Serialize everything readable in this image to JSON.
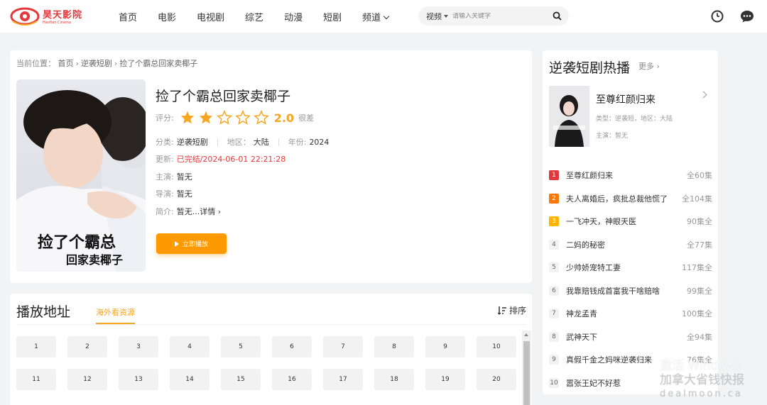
{
  "header": {
    "logo_cn": "昊天影院",
    "logo_en": "Haotian Cinema",
    "nav": [
      "首页",
      "电影",
      "电视剧",
      "综艺",
      "动漫",
      "短剧",
      "频道"
    ],
    "search": {
      "category": "视频",
      "placeholder": "请输入关键字"
    }
  },
  "breadcrumb": {
    "label": "当前位置：",
    "items": [
      "首页",
      "逆袭短剧",
      "捡了个霸总回家卖椰子"
    ]
  },
  "detail": {
    "title": "捡了个霸总回家卖椰子",
    "poster_caption_1": "捡了个霸总",
    "poster_caption_2": "回家卖椰子",
    "rating_label": "评分:",
    "rating_value": 2,
    "rating_max": 5,
    "score": "2.0",
    "score_text": "很差",
    "category_label": "分类:",
    "category": "逆袭短剧",
    "region_label": "地区：",
    "region": "大陆",
    "year_label": "年份:",
    "year": "2024",
    "update_label": "更新:",
    "update": "已完结/2024-06-01 22:21:28",
    "starring_label": "主演:",
    "starring": "暂无",
    "director_label": "导演:",
    "director": "暂无",
    "intro_label": "简介:",
    "intro": "暂无...",
    "intro_more": "详情 ›",
    "play_button": "立即播放"
  },
  "playlist": {
    "title": "播放地址",
    "source": "海外看资源",
    "sort": "排序",
    "episodes": [
      "1",
      "2",
      "3",
      "4",
      "5",
      "6",
      "7",
      "8",
      "9",
      "10",
      "11",
      "12",
      "13",
      "14",
      "15",
      "16",
      "17",
      "18",
      "19",
      "20"
    ]
  },
  "sidebar": {
    "title": "逆袭短剧热播",
    "more": "更多 ›",
    "featured": {
      "title": "至尊红颜归来",
      "type_line": "类型：逆袭短，地区：大陆",
      "cast_line": "主演：暂无"
    },
    "ranks": [
      {
        "num": "1",
        "name": "至尊红颜归来",
        "ep": "全60集"
      },
      {
        "num": "2",
        "name": "夫人离婚后，疯批总裁他慌了",
        "ep": "全104集"
      },
      {
        "num": "3",
        "name": "一飞冲天，神眼天医",
        "ep": "90集全"
      },
      {
        "num": "4",
        "name": "二妈的秘密",
        "ep": "全77集"
      },
      {
        "num": "5",
        "name": "少帅娇宠特工妻",
        "ep": "117集全"
      },
      {
        "num": "6",
        "name": "我靠赔钱成首富我干啥赔啥",
        "ep": "99集全"
      },
      {
        "num": "7",
        "name": "神龙孟青",
        "ep": "100集全"
      },
      {
        "num": "8",
        "name": "武神天下",
        "ep": "全94集"
      },
      {
        "num": "9",
        "name": "真假千金之妈咪逆袭归来",
        "ep": "76集全"
      },
      {
        "num": "10",
        "name": "嚣张王妃不好惹",
        "ep": ""
      }
    ]
  },
  "watermark": {
    "line1": "激活 Windows",
    "line2": "加拿大省钱快报",
    "line3": "dealmoon.ca"
  },
  "colors": {
    "accent": "#f5a623",
    "play_button": "#ff9900",
    "red": "#e4393c"
  }
}
